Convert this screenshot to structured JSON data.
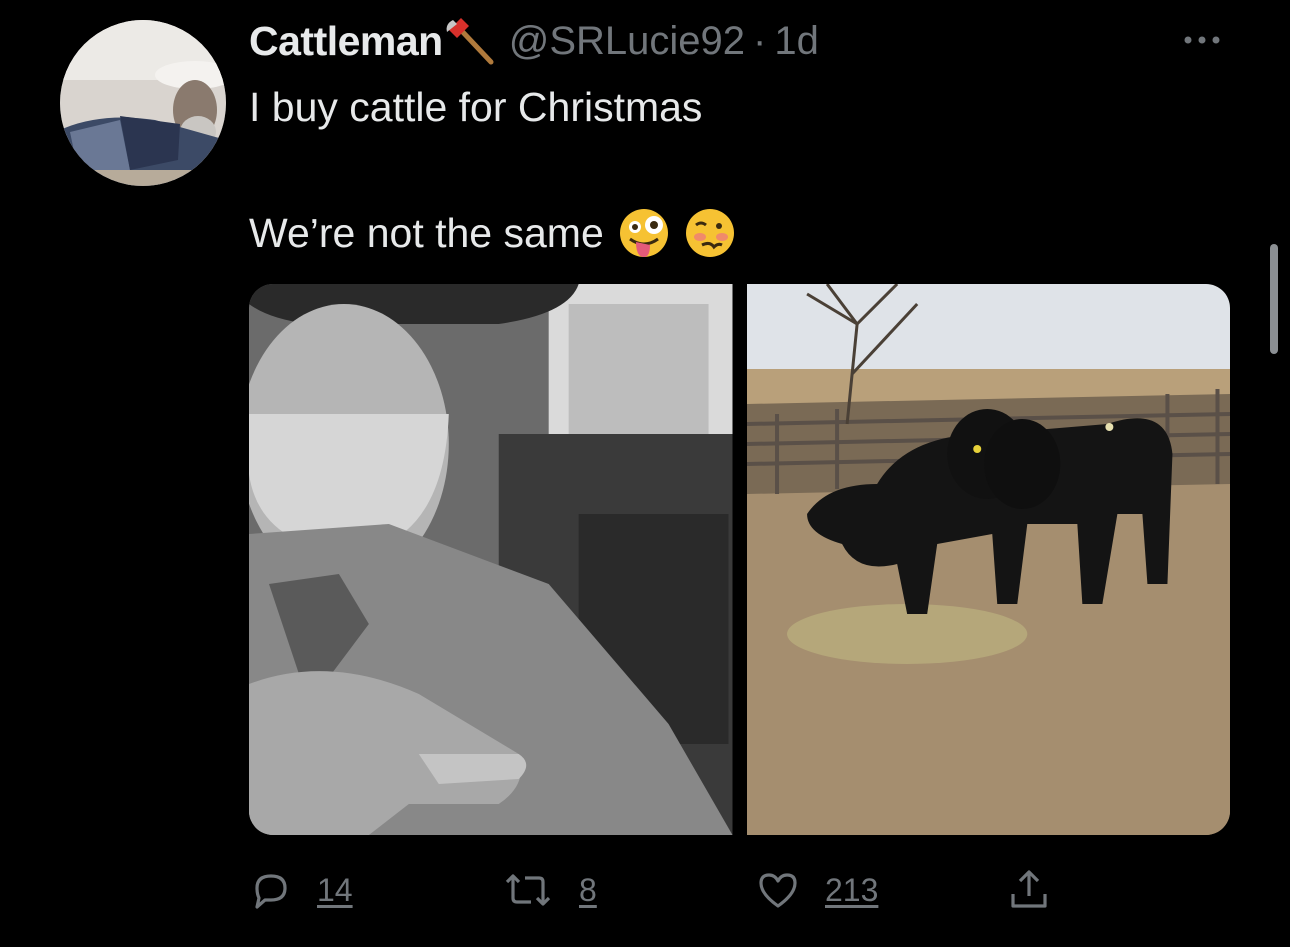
{
  "tweet": {
    "display_name": "Cattleman",
    "name_emoji": "axe-emoji",
    "handle": "@SRLucie92",
    "separator": "·",
    "time": "1d",
    "line1": "I buy cattle for Christmas",
    "line2": "We’re not the same",
    "line2_emojis": [
      "zany-face-emoji",
      "woozy-face-emoji"
    ]
  },
  "media": {
    "photos": [
      {
        "name": "selfie-photo"
      },
      {
        "name": "cattle-photo"
      }
    ]
  },
  "actions": {
    "reply_count": "14",
    "retweet_count": "8",
    "like_count": "213"
  },
  "icons": {
    "reply": "reply-icon",
    "retweet": "retweet-icon",
    "like": "heart-icon",
    "share": "share-icon",
    "more": "more-icon"
  },
  "colors": {
    "background": "#000000",
    "text_primary": "#e7e9ea",
    "text_secondary": "#71767b"
  }
}
